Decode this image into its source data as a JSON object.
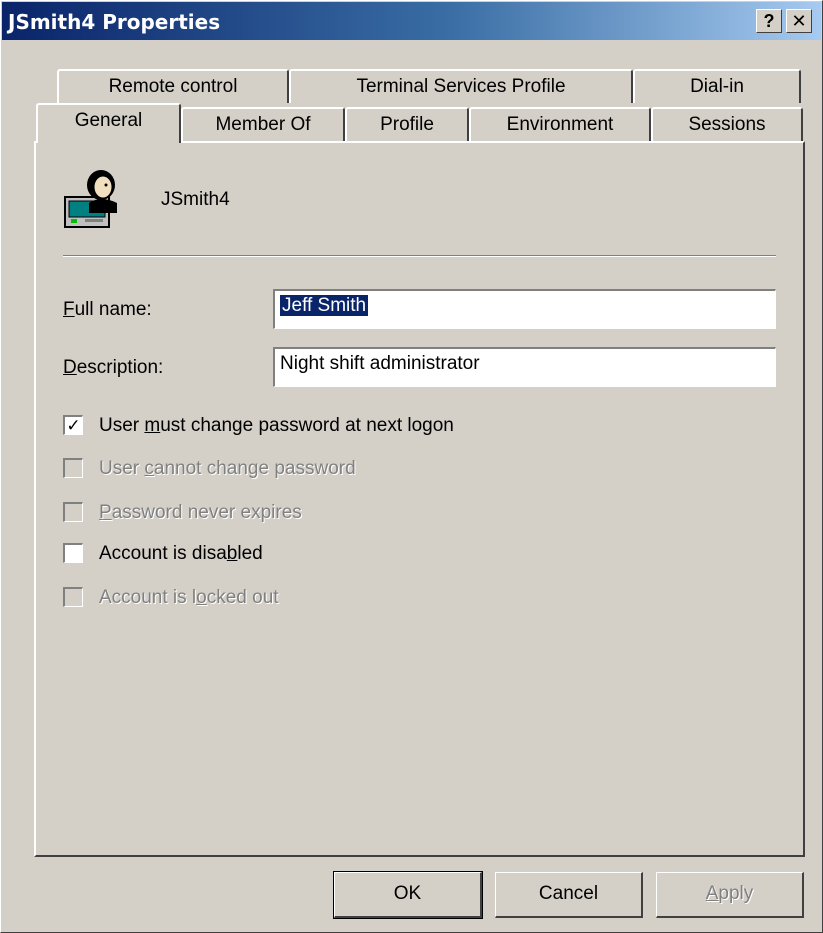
{
  "window": {
    "title": "JSmith4 Properties",
    "help_button": "?",
    "close_button": "✕"
  },
  "tabs": {
    "row1": [
      "Remote control",
      "Terminal Services Profile",
      "Dial-in"
    ],
    "row2": [
      "General",
      "Member Of",
      "Profile",
      "Environment",
      "Sessions"
    ],
    "active": "General"
  },
  "general": {
    "username": "JSmith4",
    "icon": "user-computer-icon",
    "full_name_label": "Full name:",
    "full_name_value": "Jeff Smith",
    "description_label": "Description:",
    "description_value": "Night shift administrator",
    "checkboxes": [
      {
        "label": "User must change password at next logon",
        "checked": true,
        "enabled": true
      },
      {
        "label": "User cannot change password",
        "checked": false,
        "enabled": false
      },
      {
        "label": "Password never expires",
        "checked": false,
        "enabled": false
      },
      {
        "label": "Account is disabled",
        "checked": false,
        "enabled": true
      },
      {
        "label": "Account is locked out",
        "checked": false,
        "enabled": false
      }
    ]
  },
  "buttons": {
    "ok": "OK",
    "cancel": "Cancel",
    "apply": "Apply"
  }
}
